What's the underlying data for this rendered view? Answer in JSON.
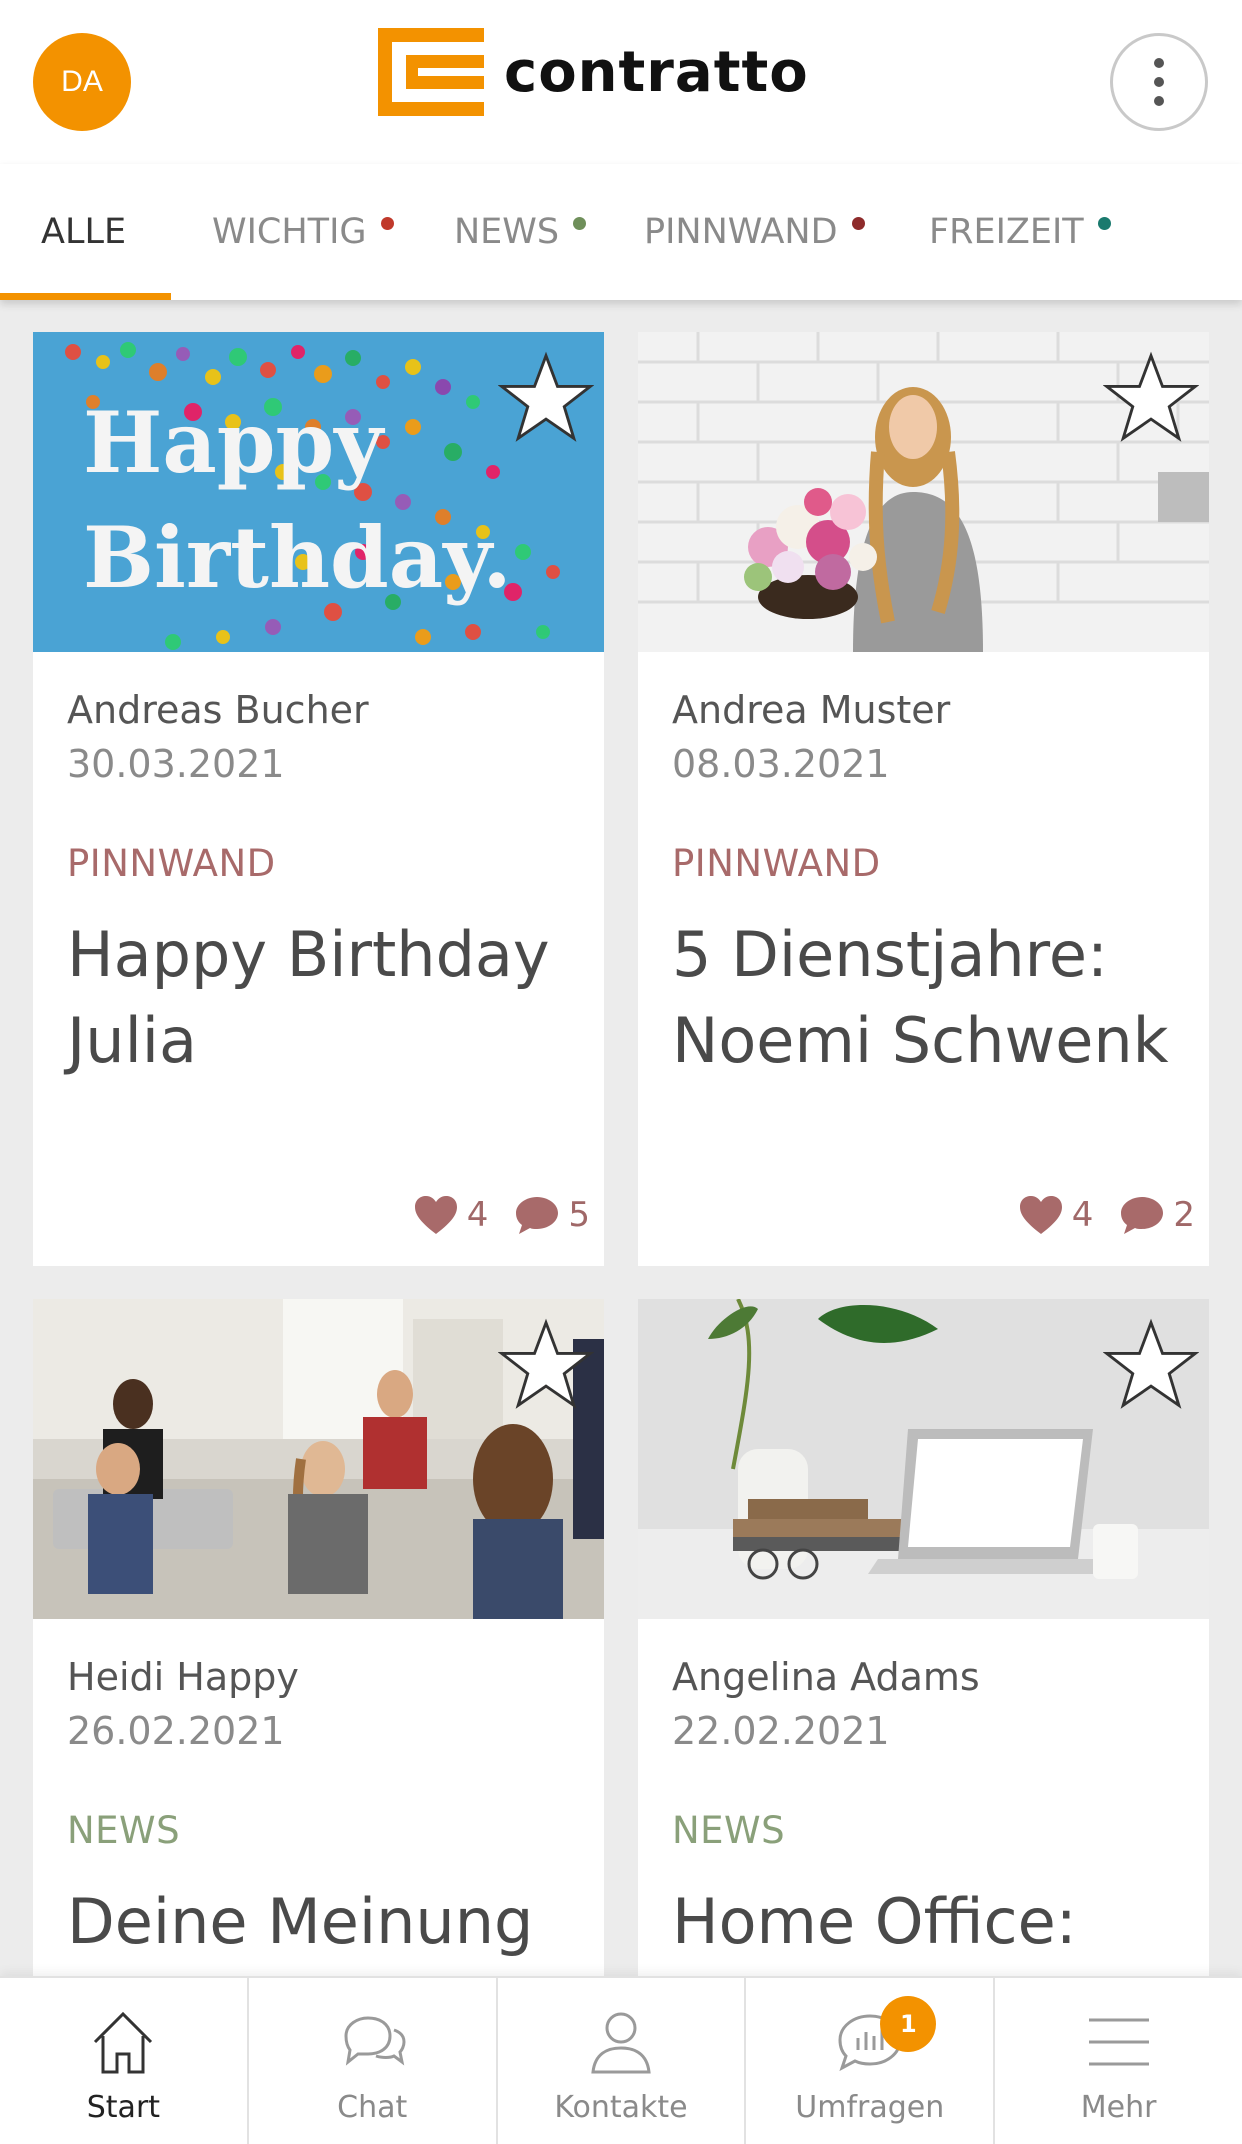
{
  "header": {
    "avatar_initials": "DA",
    "logo_text": "contratto",
    "brand_color": "#f39200"
  },
  "tabs": [
    {
      "label": "ALLE",
      "active": true,
      "dot_color": null
    },
    {
      "label": "WICHTIG",
      "active": false,
      "dot_color": "#c0392b"
    },
    {
      "label": "NEWS",
      "active": false,
      "dot_color": "#6f8f5a"
    },
    {
      "label": "PINNWAND",
      "active": false,
      "dot_color": "#8e2b2b"
    },
    {
      "label": "FREIZEIT",
      "active": false,
      "dot_color": "#1a7a6e"
    }
  ],
  "posts": [
    {
      "image_overlay": "Happy Birthday.",
      "image_line1": "Happy",
      "image_line2": "Birthday.",
      "author": "Andreas Bucher",
      "date": "30.03.2021",
      "category": "PINNWAND",
      "category_color": "#a86a6a",
      "title": "Happy Birthday Julia",
      "likes": "4",
      "comments": "5"
    },
    {
      "author": "Andrea Muster",
      "date": "08.03.2021",
      "category": "PINNWAND",
      "category_color": "#a86a6a",
      "title": "5 Dienstjahre: Noemi Schwenk",
      "likes": "4",
      "comments": "2"
    },
    {
      "author": "Heidi Happy",
      "date": "26.02.2021",
      "category": "NEWS",
      "category_color": "#8aa07a",
      "title": "Deine Meinung"
    },
    {
      "author": "Angelina Adams",
      "date": "22.02.2021",
      "category": "NEWS",
      "category_color": "#8aa07a",
      "title": "Home Office:"
    }
  ],
  "nav": [
    {
      "label": "Start",
      "icon": "home-icon",
      "active": true
    },
    {
      "label": "Chat",
      "icon": "chat-icon",
      "active": false
    },
    {
      "label": "Kontakte",
      "icon": "contacts-icon",
      "active": false
    },
    {
      "label": "Umfragen",
      "icon": "poll-icon",
      "active": false,
      "badge": "1"
    },
    {
      "label": "Mehr",
      "icon": "menu-icon",
      "active": false
    }
  ]
}
